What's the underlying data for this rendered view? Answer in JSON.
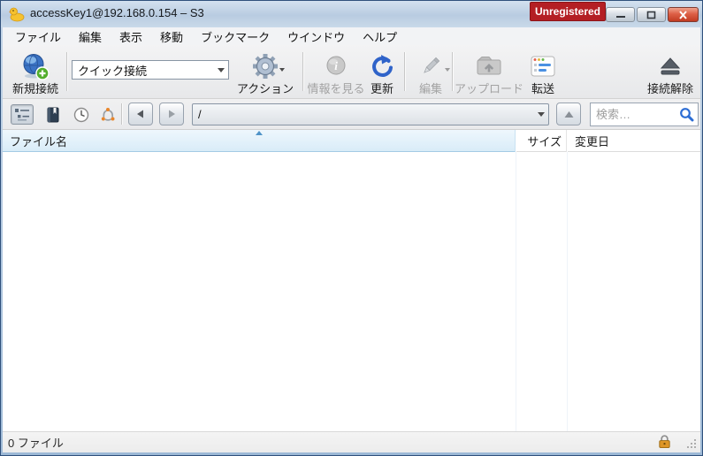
{
  "window": {
    "title": "accessKey1@192.168.0.154 – S3",
    "registration_badge": "Unregistered"
  },
  "menubar": {
    "items": [
      "ファイル",
      "編集",
      "表示",
      "移動",
      "ブックマーク",
      "ウインドウ",
      "ヘルプ"
    ]
  },
  "toolbar": {
    "new_connection_label": "新規接続",
    "quick_connect_value": "クイック接続",
    "action_label": "アクション",
    "get_info_label": "情報を見る",
    "refresh_label": "更新",
    "edit_label": "編集",
    "upload_label": "アップロード",
    "transfers_label": "転送",
    "disconnect_label": "接続解除"
  },
  "navbar": {
    "path_value": "/",
    "search_placeholder": "検索…"
  },
  "file_table": {
    "columns": [
      {
        "label": "ファイル名",
        "sorted": "ascending"
      },
      {
        "label": "サイズ"
      },
      {
        "label": "変更日"
      }
    ],
    "rows": []
  },
  "statusbar": {
    "file_count_text": "0 ファイル"
  },
  "icons": {
    "app": "duck-icon",
    "new_connection": "globe-plus-icon",
    "action": "gear-icon",
    "get_info": "info-circle-icon",
    "refresh": "circular-arrow-icon",
    "edit": "pencil-icon",
    "upload": "folder-up-icon",
    "transfers": "transfer-window-icon",
    "disconnect": "eject-icon",
    "search": "magnifier-icon",
    "security": "padlock-icon"
  },
  "colors": {
    "badge_bg": "#b41f24",
    "titlebar": "#bfd2e6",
    "sorted_header_bg": "#ddeef9",
    "accent_blue": "#2b6cd4"
  }
}
